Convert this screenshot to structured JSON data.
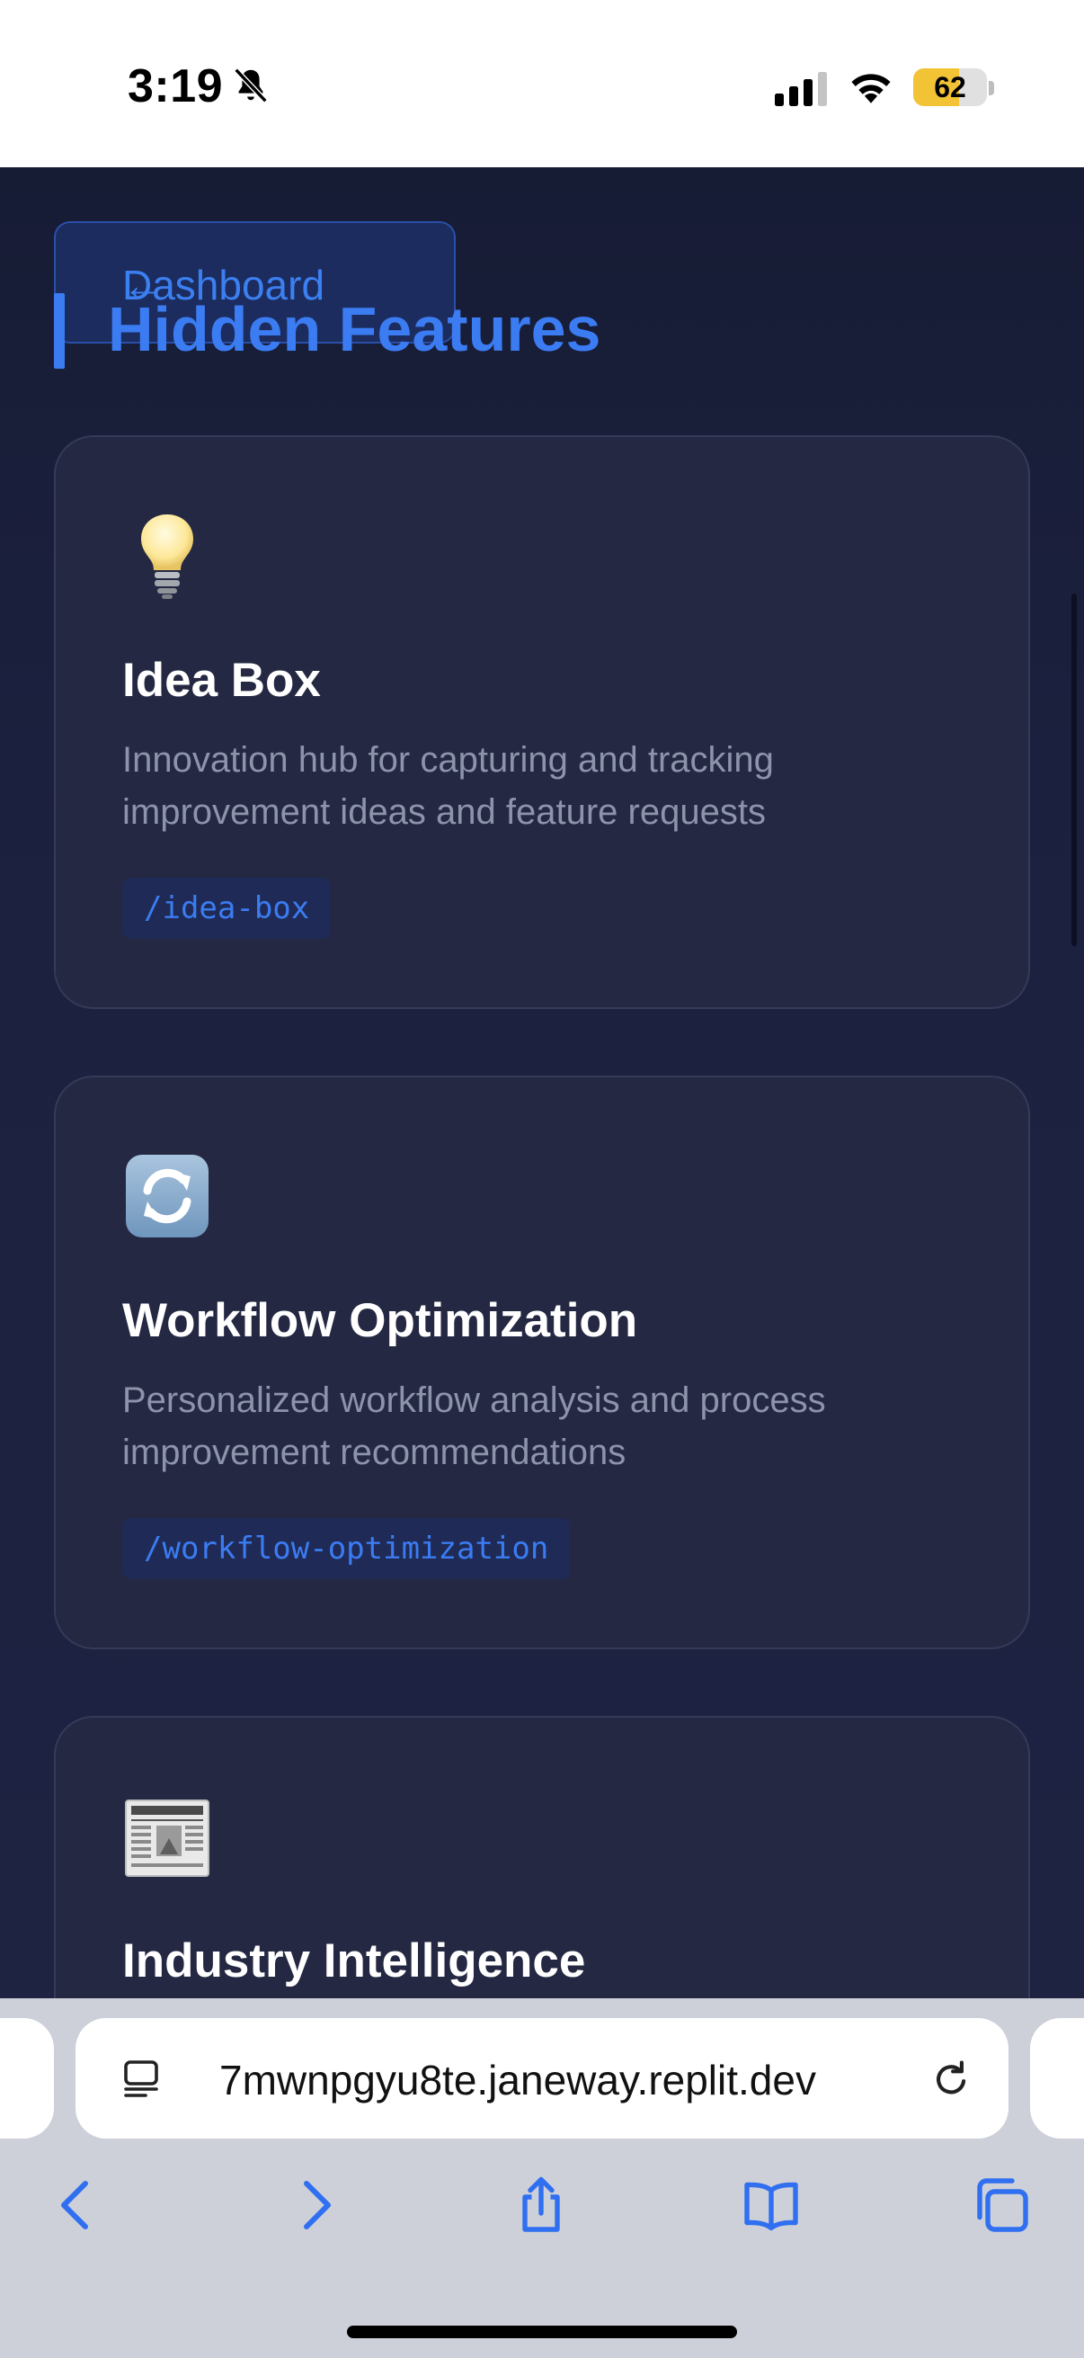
{
  "status_bar": {
    "time": "3:19",
    "battery_level": "62",
    "battery_fraction": 0.62,
    "icons": [
      "bell-slash-icon",
      "signal-icon",
      "wifi-icon",
      "battery-icon"
    ]
  },
  "header": {
    "back_arrow": "←",
    "back_label": "Dashboard",
    "section_title": "Hidden Features"
  },
  "cards": [
    {
      "icon": "lightbulb-icon",
      "title": "Idea Box",
      "description": "Innovation hub for capturing and tracking improvement ideas and feature requests",
      "route": "/idea-box"
    },
    {
      "icon": "refresh-arrows-icon",
      "title": "Workflow Optimization",
      "description": "Personalized workflow analysis and process improvement recommendations",
      "route": "/workflow-optimization"
    },
    {
      "icon": "newspaper-icon",
      "title": "Industry Intelligence",
      "description": "",
      "route": ""
    }
  ],
  "browser": {
    "url": "7mwnpgyu8te.janeway.replit.dev",
    "accent_color": "#2f6ff0",
    "nav_icons": [
      "back-icon",
      "forward-icon",
      "share-icon",
      "bookmarks-icon",
      "tabs-icon"
    ]
  },
  "colors": {
    "accent": "#3b7cf2",
    "background": "#1b1f3a",
    "card": "#242842"
  }
}
